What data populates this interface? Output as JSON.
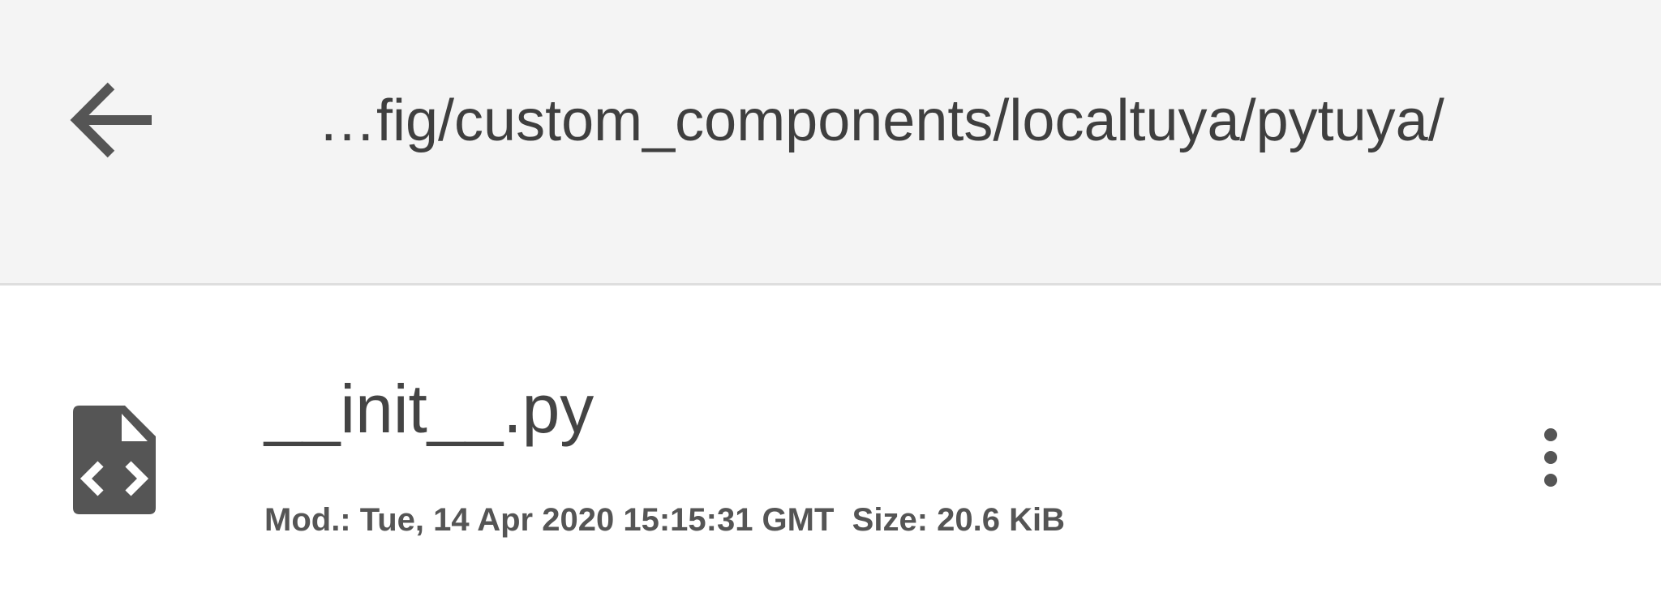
{
  "header": {
    "back_icon": "arrow-left-icon",
    "path": "…fig/custom_components/localtuya/pytuya/"
  },
  "files": [
    {
      "icon": "code-file-icon",
      "name": "__init__.py",
      "meta": "Mod.: Tue, 14 Apr 2020 15:15:31 GMT  Size: 20.6 KiB",
      "menu_icon": "more-vertical-icon"
    }
  ],
  "colors": {
    "header_bg": "#f4f4f4",
    "divider": "#dedede",
    "icon": "#555555",
    "text_primary": "#444444",
    "text_secondary": "#555555"
  }
}
